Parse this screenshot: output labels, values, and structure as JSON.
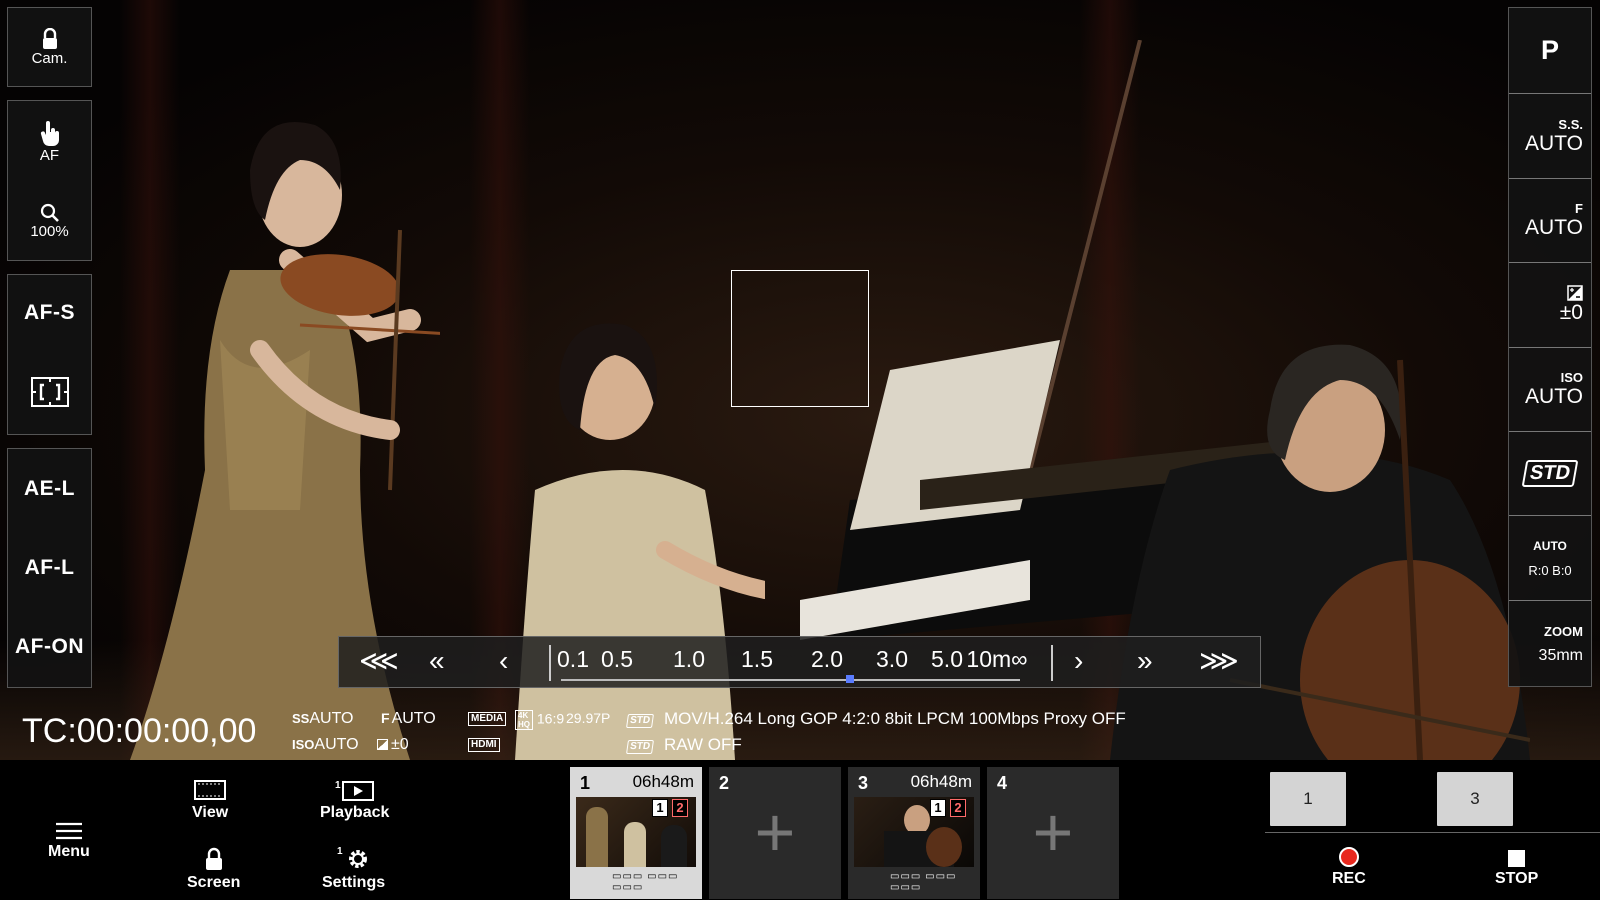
{
  "left_panel": {
    "cam_lock_label": "Cam.",
    "af_touch_label": "AF",
    "zoom_label": "100%",
    "af_mode": "AF-S",
    "ae_lock": "AE-L",
    "af_lock": "AF-L",
    "af_on": "AF-ON"
  },
  "right_panel": {
    "mode": "P",
    "shutter_label": "S.S.",
    "shutter_value": "AUTO",
    "f_label": "F",
    "f_value": "AUTO",
    "exposure_value": "±0",
    "iso_label": "ISO",
    "iso_value": "AUTO",
    "picture_style": "STD",
    "wb_label": "AUTO",
    "wb_value": "R:0 B:0",
    "zoom_label": "ZOOM",
    "zoom_value": "35mm"
  },
  "focus_bar": {
    "ticks": [
      "0.1",
      "0.5",
      "1.0",
      "1.5",
      "2.0",
      "3.0",
      "5.0",
      "10m∞"
    ],
    "position": 0.63
  },
  "status": {
    "timecode": "TC:00:00:00,00",
    "ss_prefix": "SS",
    "ss": "AUTO",
    "f_prefix": "F",
    "f": "AUTO",
    "iso_prefix": "ISO",
    "iso": "AUTO",
    "exposure": "±0",
    "media_tag": "MEDIA",
    "aspect": "16:9",
    "framerate": "29.97P",
    "hdmi_tag": "HDMI",
    "std_tag": "STD",
    "format": "MOV/H.264 Long GOP 4:2:0 8bit LPCM 100Mbps Proxy OFF",
    "raw": "RAW OFF"
  },
  "bottom": {
    "menu": "Menu",
    "view": "View",
    "playback": "Playback",
    "screen": "Screen",
    "settings": "Settings",
    "slots": [
      {
        "num": "1",
        "time": "06h48m"
      },
      {
        "num": "2",
        "time": ""
      },
      {
        "num": "3",
        "time": "06h48m"
      },
      {
        "num": "4",
        "time": ""
      }
    ],
    "badge1": "1",
    "badge2": "2",
    "assign1": "1",
    "assign3": "3",
    "rec": "REC",
    "stop": "STOP"
  }
}
